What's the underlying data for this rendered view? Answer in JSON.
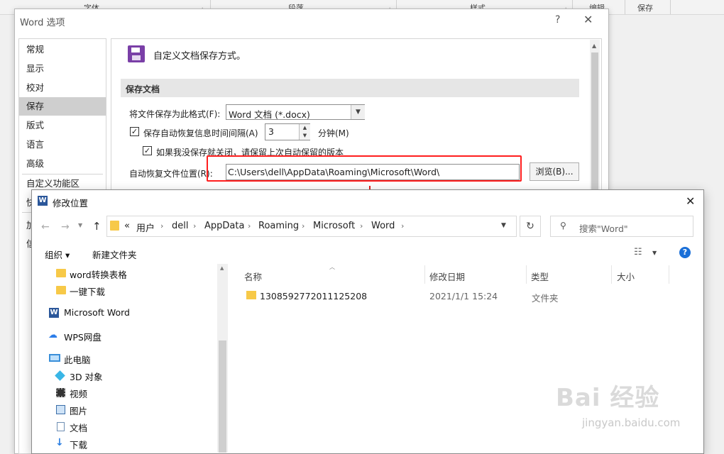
{
  "ribbon": {
    "groups": [
      "字体",
      "段落",
      "样式",
      "编辑",
      "保存"
    ],
    "launcher_icon": "launcher-icon"
  },
  "options_dialog": {
    "title": "Word 选项",
    "help": "?",
    "close": "✕",
    "nav": [
      "常规",
      "显示",
      "校对",
      "保存",
      "版式",
      "语言",
      "高级",
      "自定义功能区",
      "快",
      "加",
      "信"
    ],
    "selected_nav": "保存",
    "heading": "自定义文档保存方式。",
    "section": "保存文档",
    "format_label": "将文件保存为此格式(F):",
    "format_value": "Word 文档 (*.docx)",
    "autosave_label": "保存自动恢复信息时间间隔(A)",
    "autosave_minutes": "3",
    "minutes_label": "分钟(M)",
    "keep_last_label": "如果我没保存就关闭，请保留上次自动保留的版本",
    "autorecover_label": "自动恢复文件位置(R):",
    "autorecover_path": "C:\\Users\\dell\\AppData\\Roaming\\Microsoft\\Word\\",
    "browse_label": "浏览(B)..."
  },
  "modify_dialog": {
    "title": "修改位置",
    "close": "✕",
    "breadcrumb": [
      "«",
      "用户",
      "dell",
      "AppData",
      "Roaming",
      "Microsoft",
      "Word"
    ],
    "search_placeholder": "搜索\"Word\"",
    "toolbar": {
      "organize": "组织 ▾",
      "new_folder": "新建文件夹"
    },
    "tree": [
      "word转换表格",
      "一键下载",
      "Microsoft Word",
      "WPS网盘",
      "此电脑",
      "3D 对象",
      "视频",
      "图片",
      "文档",
      "下载"
    ],
    "columns": [
      "名称",
      "修改日期",
      "类型",
      "大小"
    ],
    "rows": [
      {
        "name": "1308592772011125208",
        "date": "2021/1/1 15:24",
        "type": "文件夹",
        "size": ""
      }
    ]
  },
  "watermark": {
    "main": "Bai 经验",
    "sub": "jingyan.baidu.com"
  },
  "colors": {
    "highlight": "#ff1e1e",
    "arrow": "#e02020",
    "selected_nav": "#cfcfcf",
    "accent": "#2b579a"
  }
}
